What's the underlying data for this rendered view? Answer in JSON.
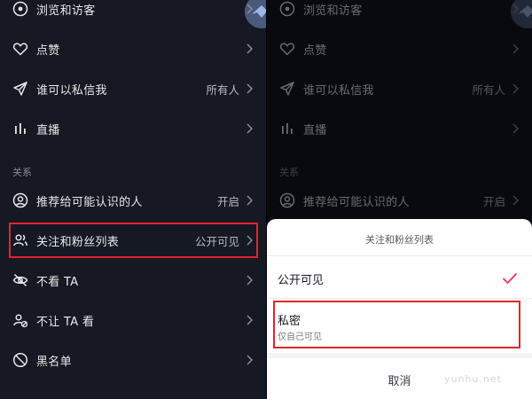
{
  "colors": {
    "background": "#161823",
    "text": "#e8e8ea",
    "muted": "#b9bac0",
    "highlight": "#e0252b",
    "check": "#fe2c55"
  },
  "settings": {
    "items_top": [
      {
        "label": "浏览和访客",
        "value": "",
        "icon": "eye-icon"
      },
      {
        "label": "点赞",
        "value": "",
        "icon": "heart-icon"
      },
      {
        "label": "谁可以私信我",
        "value": "所有人",
        "icon": "paper-plane-icon"
      },
      {
        "label": "直播",
        "value": "",
        "icon": "live-bars-icon"
      }
    ],
    "section_label": "关系",
    "items_relation": [
      {
        "label": "推荐给可能认识的人",
        "value": "开启",
        "icon": "user-circle-icon"
      },
      {
        "label": "关注和粉丝列表",
        "value": "公开可见",
        "icon": "users-icon"
      },
      {
        "label": "不看 TA",
        "value": "",
        "icon": "eye-off-icon"
      },
      {
        "label": "不让 TA 看",
        "value": "",
        "icon": "user-block-icon"
      },
      {
        "label": "黑名单",
        "value": "",
        "icon": "ban-icon"
      }
    ]
  },
  "sheet": {
    "title": "关注和粉丝列表",
    "options": [
      {
        "label": "公开可见",
        "sub": "",
        "selected": true
      },
      {
        "label": "私密",
        "sub": "仅自己可见",
        "selected": false
      }
    ],
    "cancel": "取消"
  },
  "watermark": "yunhu.net"
}
